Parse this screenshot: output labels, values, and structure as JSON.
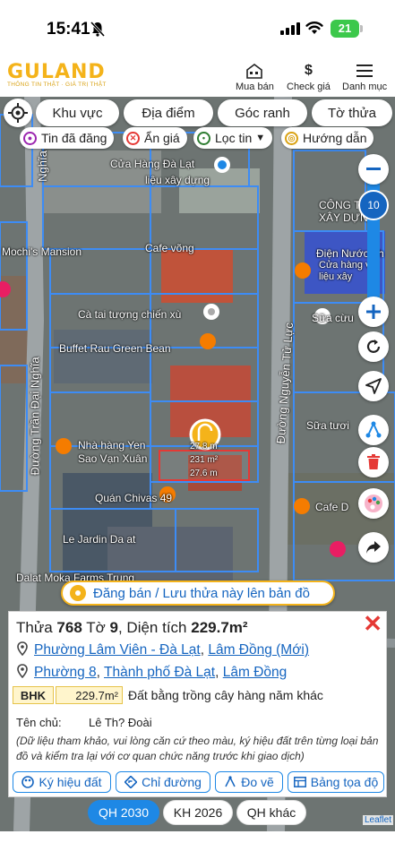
{
  "status_bar": {
    "time": "15:41",
    "battery": "21"
  },
  "header": {
    "logo_text": "GULAND",
    "logo_tagline": "THÔNG TIN THẬT · GIÁ TRỊ THẬT",
    "nav": [
      {
        "label": "Mua bán",
        "icon": "house-icon"
      },
      {
        "label": "Check giá",
        "icon": "dollar-icon"
      },
      {
        "label": "Danh mục",
        "icon": "menu-icon"
      }
    ]
  },
  "filters": {
    "chips": [
      "Khu vực",
      "Địa điểm",
      "Góc ranh",
      "Tờ thửa"
    ],
    "tags": [
      {
        "label": "Tin đã đăng",
        "color": "#9c27b0"
      },
      {
        "label": "Ẩn giá",
        "color": "#e53935"
      },
      {
        "label": "Lọc tin",
        "color": "#2e7d32"
      },
      {
        "label": "Hướng dẫn",
        "color": "#d9a214"
      }
    ]
  },
  "map": {
    "zoom_level": "10",
    "labels": {
      "store_dalat": "Cửa Hàng Đà Lạt",
      "materials": "liệu xây dựng",
      "mochis": "Mochi's Mansion",
      "cafe_vong": "Cafe võng",
      "cong_ty": "CÔNG TY",
      "xay_dung": "XÂY DỰNG",
      "dien_nuoc": "Điện Nước Th",
      "cua_hang_vat": "Cửa hàng vật",
      "lieu_xay": "liệu xây",
      "ca_tai": "Cà tai tượng chiến xù",
      "buffet": "Buffet Rau Green Bean",
      "sua_cuu": "Sữa cừu",
      "sua_tuoi": "Sữa tươi",
      "nha_hang": "Nhà hàng Yen",
      "sao_van": "Sao Vạn Xuân",
      "quan_chivas": "Quán Chivas 49",
      "le_jardin": "Le Jardin Da at",
      "dalat_moka": "Dalat Moka Farms Trung",
      "cafe_d": "Cafe D",
      "road_tran_dai_nghia": "Đường Trần Đại Nghĩa",
      "road_nguyen_tu_luc": "Đường Nguyễn Tử Lực",
      "road_nghia_top": "Nghĩa"
    },
    "parcel_dims": {
      "top": "27.8 m",
      "right": "231 m²",
      "bottom": "27.6 m"
    },
    "post_banner": "Đăng bán / Lưu thửa này lên bản đồ"
  },
  "parcel": {
    "title_prefix": "Thửa",
    "parcel_no": "768",
    "sheet_prefix": "Tờ",
    "sheet_no": "9",
    "area_prefix": "Diện tích",
    "area": "229.7m²",
    "address_new": {
      "ward": "Phường Lâm Viên - Đà Lạt",
      "province": "Lâm Đồng (Mới)"
    },
    "address_old": {
      "ward": "Phường 8",
      "city": "Thành phố Đà Lạt",
      "province": "Lâm Đồng"
    },
    "land_code": "BHK",
    "land_area": "229.7m²",
    "land_desc": "Đất bằng trồng cây hàng năm khác",
    "owner_label": "Tên chủ:",
    "owner_name": "Lê Th? Đoài",
    "disclaimer": "(Dữ liệu tham khảo, vui lòng căn cứ theo màu, ký hiệu đất trên từng loại bản đồ và kiểm tra lại với cơ quan chức năng trước khi giao dịch)",
    "actions": [
      "Ký hiệu đất",
      "Chỉ đường",
      "Đo vẽ",
      "Bảng tọa độ"
    ]
  },
  "plan_tabs": [
    {
      "label": "QH 2030",
      "active": true
    },
    {
      "label": "KH 2026",
      "active": false
    },
    {
      "label": "QH khác",
      "active": false
    }
  ],
  "attribution": "Leaflet",
  "colors": {
    "brand": "#f4b31a",
    "accent": "#1e88e5",
    "close": "#e53935"
  }
}
